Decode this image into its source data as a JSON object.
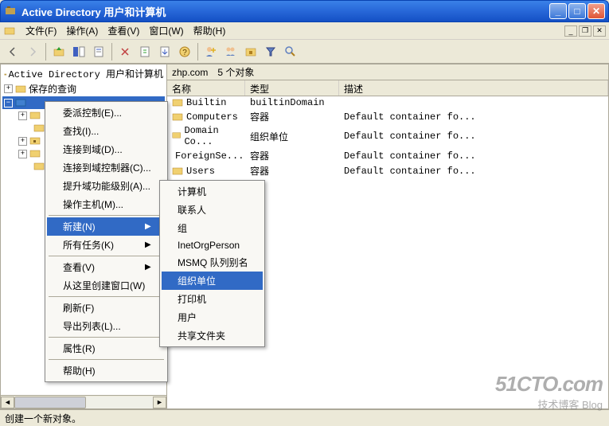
{
  "titlebar": {
    "title": "Active Directory 用户和计算机"
  },
  "menubar": {
    "items": [
      {
        "label": "文件(F)"
      },
      {
        "label": "操作(A)"
      },
      {
        "label": "查看(V)"
      },
      {
        "label": "窗口(W)"
      },
      {
        "label": "帮助(H)"
      }
    ]
  },
  "tree": {
    "root": "Active Directory 用户和计算机",
    "saved_queries": "保存的查询",
    "domain_icon": "zhp",
    "children_count_placeholder": "..."
  },
  "address": {
    "path": "zhp.com",
    "count": "5 个对象"
  },
  "list": {
    "headers": [
      "名称",
      "类型",
      "描述"
    ],
    "rows": [
      {
        "name": "Builtin",
        "type": "builtinDomain",
        "desc": ""
      },
      {
        "name": "Computers",
        "type": "容器",
        "desc": "Default container fo..."
      },
      {
        "name": "Domain Co...",
        "type": "组织单位",
        "desc": "Default container fo..."
      },
      {
        "name": "ForeignSe...",
        "type": "容器",
        "desc": "Default container fo..."
      },
      {
        "name": "Users",
        "type": "容器",
        "desc": "Default container fo..."
      }
    ]
  },
  "context_menu": {
    "items": [
      {
        "label": "委派控制(E)..."
      },
      {
        "label": "查找(I)..."
      },
      {
        "label": "连接到域(D)..."
      },
      {
        "label": "连接到域控制器(C)..."
      },
      {
        "label": "提升域功能级别(A)..."
      },
      {
        "label": "操作主机(M)..."
      },
      {
        "sep": true
      },
      {
        "label": "新建(N)",
        "submenu": true,
        "highlighted": true
      },
      {
        "label": "所有任务(K)",
        "submenu": true
      },
      {
        "sep": true
      },
      {
        "label": "查看(V)",
        "submenu": true
      },
      {
        "label": "从这里创建窗口(W)"
      },
      {
        "sep": true
      },
      {
        "label": "刷新(F)"
      },
      {
        "label": "导出列表(L)..."
      },
      {
        "sep": true
      },
      {
        "label": "属性(R)"
      },
      {
        "sep": true
      },
      {
        "label": "帮助(H)"
      }
    ]
  },
  "submenu": {
    "items": [
      {
        "label": "计算机"
      },
      {
        "label": "联系人"
      },
      {
        "label": "组"
      },
      {
        "label": "InetOrgPerson"
      },
      {
        "label": "MSMQ 队列别名"
      },
      {
        "label": "组织单位",
        "highlighted": true
      },
      {
        "label": "打印机"
      },
      {
        "label": "用户"
      },
      {
        "label": "共享文件夹"
      }
    ]
  },
  "statusbar": {
    "text": "创建一个新对象。"
  },
  "watermark": {
    "line1": "51CTO.com",
    "line2": "技术博客  Blog"
  }
}
